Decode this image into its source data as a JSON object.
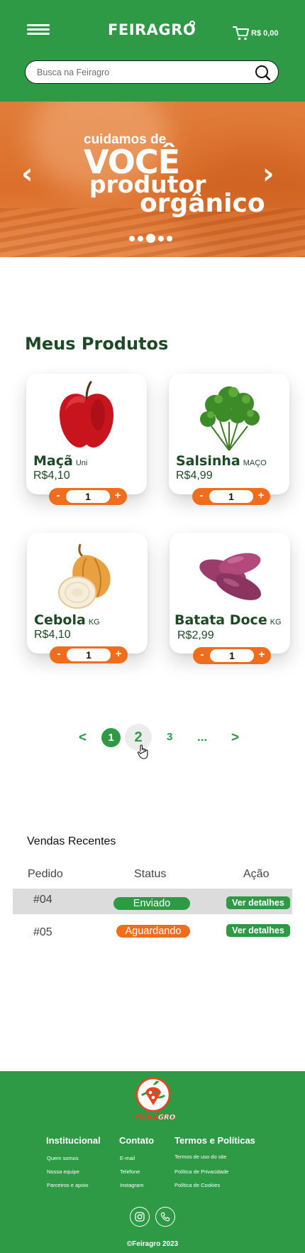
{
  "header": {
    "logo": "FEIRAGRO",
    "cart_total": "R$ 0,00",
    "search_placeholder": "Busca na Feiragro"
  },
  "banner": {
    "line1": "cuidamos de",
    "line2": "VOCÊ",
    "line3": "produtor",
    "line4": "orgânico",
    "slide_count": 5,
    "active_slide": 3
  },
  "products": {
    "title": "Meus Produtos",
    "items": [
      {
        "name": "Maçã",
        "unit": "Uni",
        "price": "R$4,10",
        "qty": "1",
        "icon": "apple-image"
      },
      {
        "name": "Salsinha",
        "unit": "MAÇO",
        "price": "R$4,99",
        "qty": "1",
        "icon": "parsley-image"
      },
      {
        "name": "Cebola",
        "unit": "KG",
        "price": "R$4,10",
        "qty": "1",
        "icon": "onion-image"
      },
      {
        "name": "Batata Doce",
        "unit": "KG",
        "price": "R$2,99",
        "qty": "1",
        "icon": "sweet-potato-image"
      }
    ],
    "minus": "-",
    "plus": "+"
  },
  "pagination": {
    "prev": "<",
    "current": "1",
    "page2": "2",
    "page3": "3",
    "more": "...",
    "next": ">"
  },
  "sales": {
    "title": "Vendas Recentes",
    "headers": [
      "Pedido",
      "Status",
      "Ação"
    ],
    "rows": [
      {
        "order": "#04",
        "status": "Enviado",
        "action": "Ver detalhes"
      },
      {
        "order": "#05",
        "status": "Aguardando",
        "action": "Ver detalhes"
      }
    ]
  },
  "footer": {
    "logo_text_a": "FEIRA",
    "logo_text_b": "GRO",
    "columns": [
      {
        "title": "Institucional",
        "links": [
          "Quem somos",
          "Nossa equipe",
          "Parceiros e apoio"
        ]
      },
      {
        "title": "Contato",
        "links": [
          "E-mail",
          "Telefone",
          "Instagram"
        ]
      },
      {
        "title": "Termos e Políticas",
        "links": [
          "Termos de uso do site",
          "Política de Privacidade",
          "Política de Cookies"
        ]
      }
    ],
    "copyright": "©Feiragro 2023"
  },
  "colors": {
    "brand_green": "#2e9a45",
    "dark_green": "#1d4a24",
    "accent_orange": "#f06d1e"
  }
}
